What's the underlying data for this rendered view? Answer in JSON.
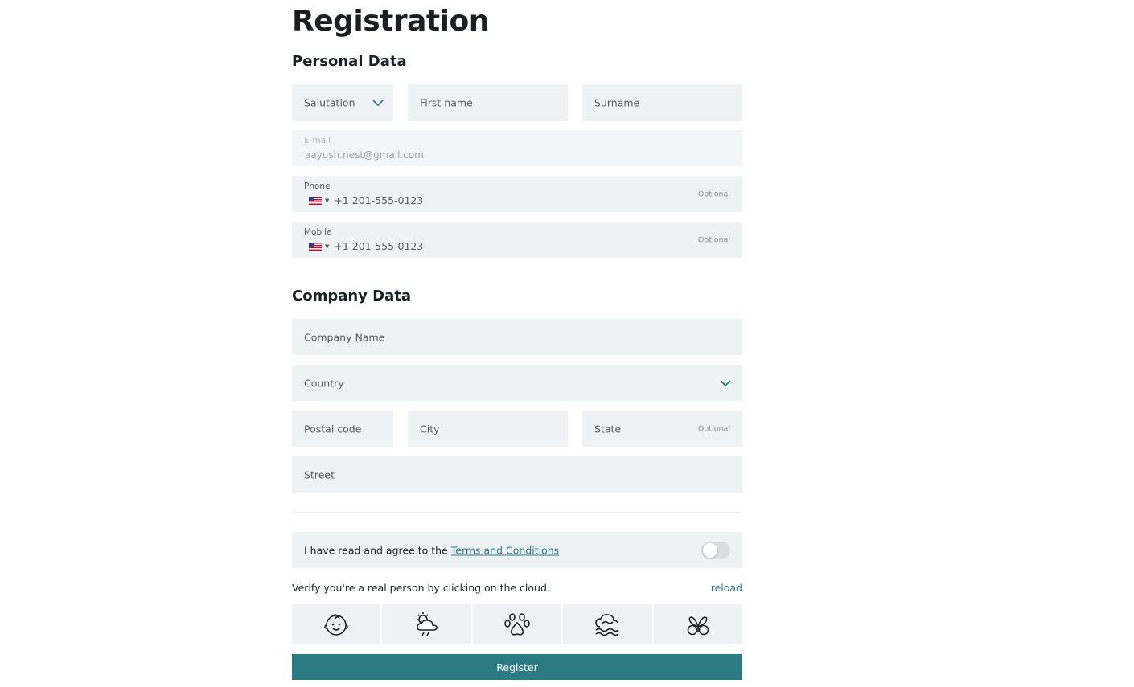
{
  "page": {
    "title": "Registration"
  },
  "personal": {
    "heading": "Personal Data",
    "salutation_placeholder": "Salutation",
    "firstname_placeholder": "First name",
    "surname_placeholder": "Surname",
    "email_label": "E-mail",
    "email_value": "aayush.nest@gmail.com",
    "phone_label": "Phone",
    "phone_value": "+1 201-555-0123",
    "phone_optional": "Optional",
    "mobile_label": "Mobile",
    "mobile_value": "+1 201-555-0123",
    "mobile_optional": "Optional"
  },
  "company": {
    "heading": "Company Data",
    "company_placeholder": "Company Name",
    "country_placeholder": "Country",
    "postal_placeholder": "Postal code",
    "city_placeholder": "City",
    "state_placeholder": "State",
    "state_optional": "Optional",
    "street_placeholder": "Street"
  },
  "terms": {
    "prefix": "I have read and agree to the ",
    "link_label": "Terms and Conditions",
    "toggle_on": false
  },
  "captcha": {
    "prompt": "Verify you're a real person by clicking on the cloud.",
    "reload_label": "reload",
    "icons": [
      "baby-face-icon",
      "sun-cloud-rain-icon",
      "paw-icon",
      "cloud-wave-icon",
      "butterfly-icon"
    ]
  },
  "actions": {
    "register_label": "Register"
  },
  "colors": {
    "accent": "#2c7a82",
    "field_bg": "#eef2f5"
  }
}
